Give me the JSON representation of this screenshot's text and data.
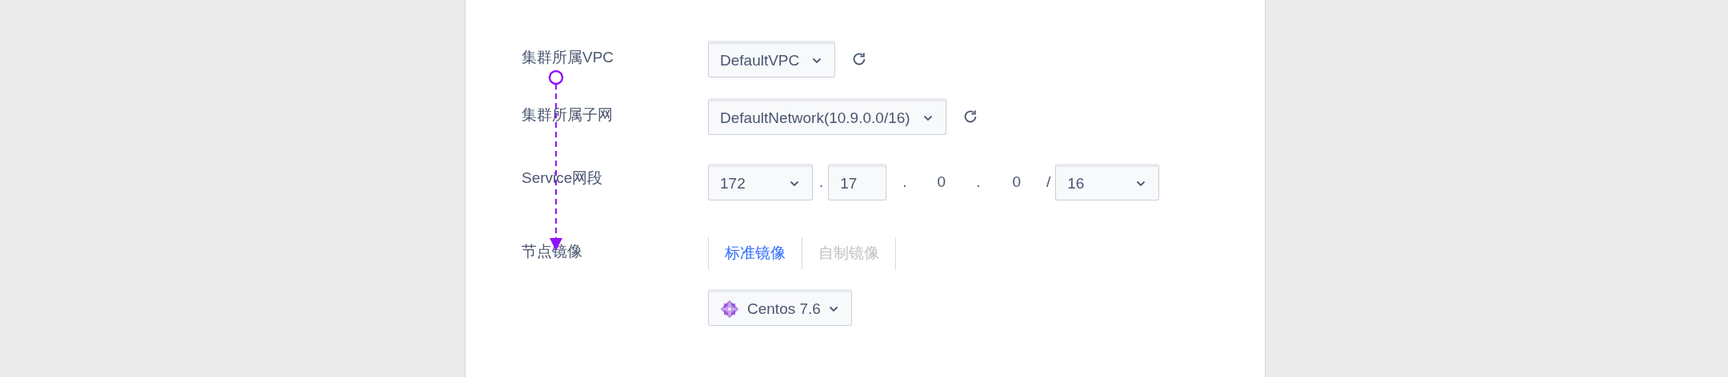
{
  "rows": [
    {
      "kind": "select",
      "label": "集群所属VPC",
      "value": "DefaultVPC",
      "refresh": true
    },
    {
      "kind": "select",
      "label": "集群所属子网",
      "value": "DefaultNetwork(10.9.0.0/16)",
      "refresh": true
    },
    {
      "kind": "cidr",
      "label": "Service网段",
      "parts": [
        {
          "kind": "select",
          "value": "172"
        },
        {
          "kind": "text",
          "text": "."
        },
        {
          "kind": "input",
          "value": "17"
        },
        {
          "kind": "text",
          "text": "."
        },
        {
          "kind": "text",
          "text": "0"
        },
        {
          "kind": "text",
          "text": "."
        },
        {
          "kind": "text",
          "text": "0"
        },
        {
          "kind": "text",
          "text": "/"
        },
        {
          "kind": "select",
          "value": "16"
        }
      ]
    },
    {
      "kind": "tabs",
      "label": "节点镜像",
      "tabs": [
        {
          "label": "标准镜像",
          "selected": true
        },
        {
          "label": "自制镜像",
          "selected": false
        }
      ]
    },
    {
      "kind": "os-select",
      "value": "Centos 7.6"
    }
  ]
}
